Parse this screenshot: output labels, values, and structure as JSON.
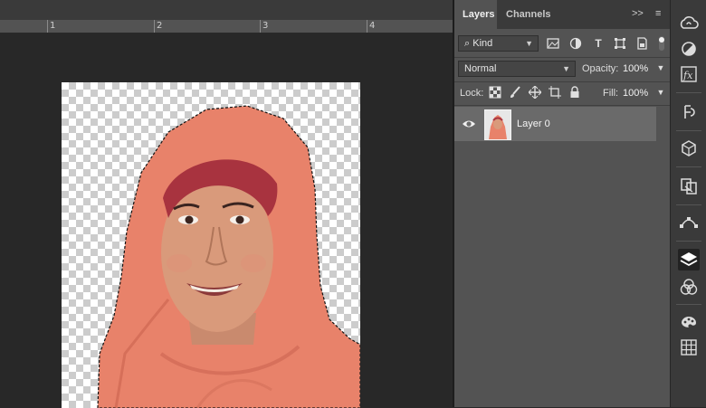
{
  "ruler": {
    "marks": [
      "1",
      "2",
      "3",
      "4"
    ]
  },
  "layers_panel": {
    "tabs": {
      "layers": "Layers",
      "channels": "Channels"
    },
    "tab_menu_glyph": ">>",
    "filter": {
      "label": "Kind"
    },
    "blend_mode": "Normal",
    "opacity": {
      "label": "Opacity:",
      "value": "100%"
    },
    "lock": {
      "label": "Lock:"
    },
    "fill": {
      "label": "Fill:",
      "value": "100%"
    },
    "layers": [
      {
        "name": "Layer 0",
        "visible": true
      }
    ]
  },
  "icons": {
    "filter_icons": [
      "image-filter-icon",
      "adjustment-filter-icon",
      "type-filter-icon",
      "shape-filter-icon",
      "smart-object-filter-icon"
    ],
    "lock_icons": [
      "lock-transparent-icon",
      "lock-image-icon",
      "lock-position-icon",
      "lock-artboard-icon",
      "lock-all-icon"
    ],
    "side_strip": [
      "creative-cloud-icon",
      "adjustments-icon",
      "styles-icon",
      "history-icon",
      "3d-icon",
      "clone-source-icon",
      "paths-icon",
      "layers-icon",
      "channels-icon",
      "color-icon",
      "swatches-icon"
    ]
  },
  "colors": {
    "panel_bg": "#535353",
    "selected_layer_bg": "#6a6a6a",
    "scarf": "#e8826a",
    "headband": "#a8333f"
  }
}
